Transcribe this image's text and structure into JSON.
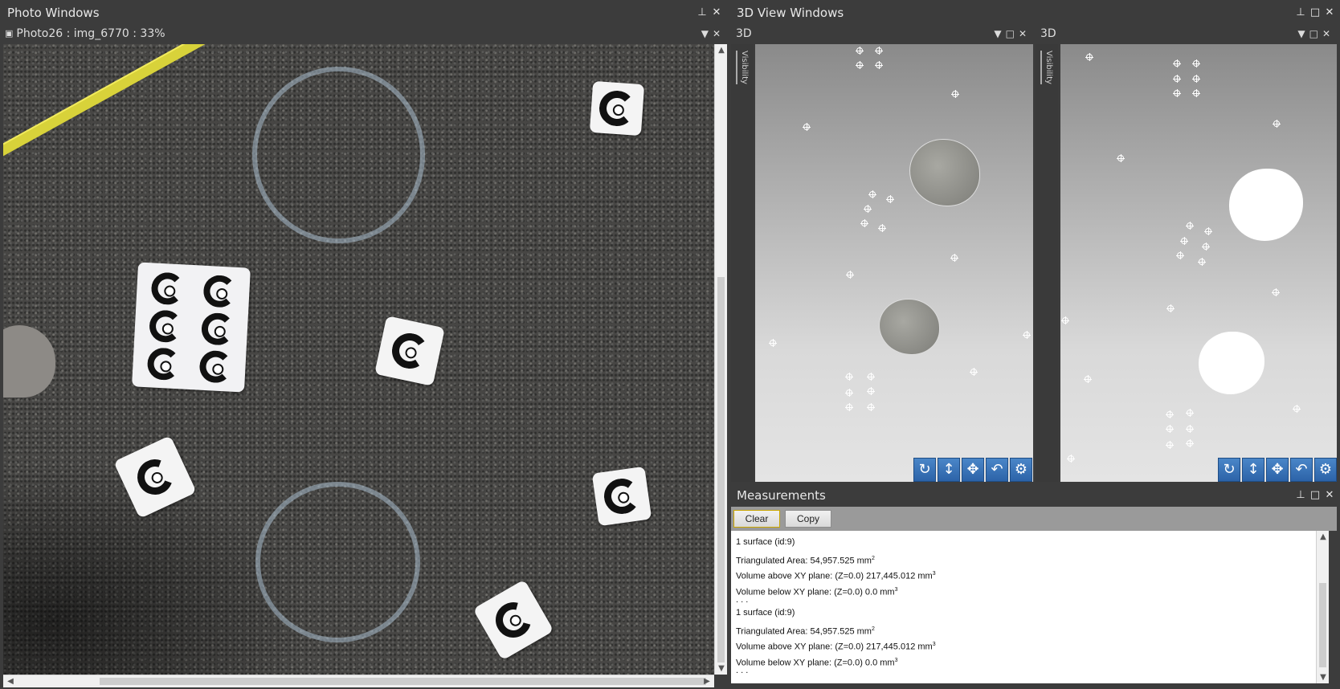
{
  "photo_window": {
    "title": "Photo Windows",
    "tab_label": "Photo26 : img_6770 : 33%"
  },
  "view_windows": {
    "title": "3D View Windows",
    "views": [
      {
        "label": "3D",
        "visibility_label": "Visibility"
      },
      {
        "label": "3D",
        "visibility_label": "Visibility"
      }
    ]
  },
  "measurements": {
    "title": "Measurements",
    "clear_label": "Clear",
    "copy_label": "Copy",
    "blocks": [
      {
        "surface": "1 surface (id:9)",
        "area": "Triangulated Area: 54,957.525 mm",
        "vol_above": "Volume above XY plane: (Z=0.0) 217,445.012 mm",
        "vol_below": "Volume below XY plane: (Z=0.0) 0.0 mm",
        "ellipsis": ". . ."
      },
      {
        "surface": "1 surface (id:9)",
        "area": "Triangulated Area: 54,957.525 mm",
        "vol_above": "Volume above XY plane: (Z=0.0) 217,445.012 mm",
        "vol_below": "Volume below XY plane: (Z=0.0) 0.0 mm",
        "ellipsis": ". . ."
      }
    ],
    "sup2": "2",
    "sup3": "3"
  },
  "toolbar_icons": [
    "rotate-icon",
    "zoom-icon",
    "pan-icon",
    "undo-icon",
    "settings-icon"
  ],
  "colors": {
    "accent_blue": "#2c63a8",
    "panel_dark": "#3c3c3c"
  }
}
